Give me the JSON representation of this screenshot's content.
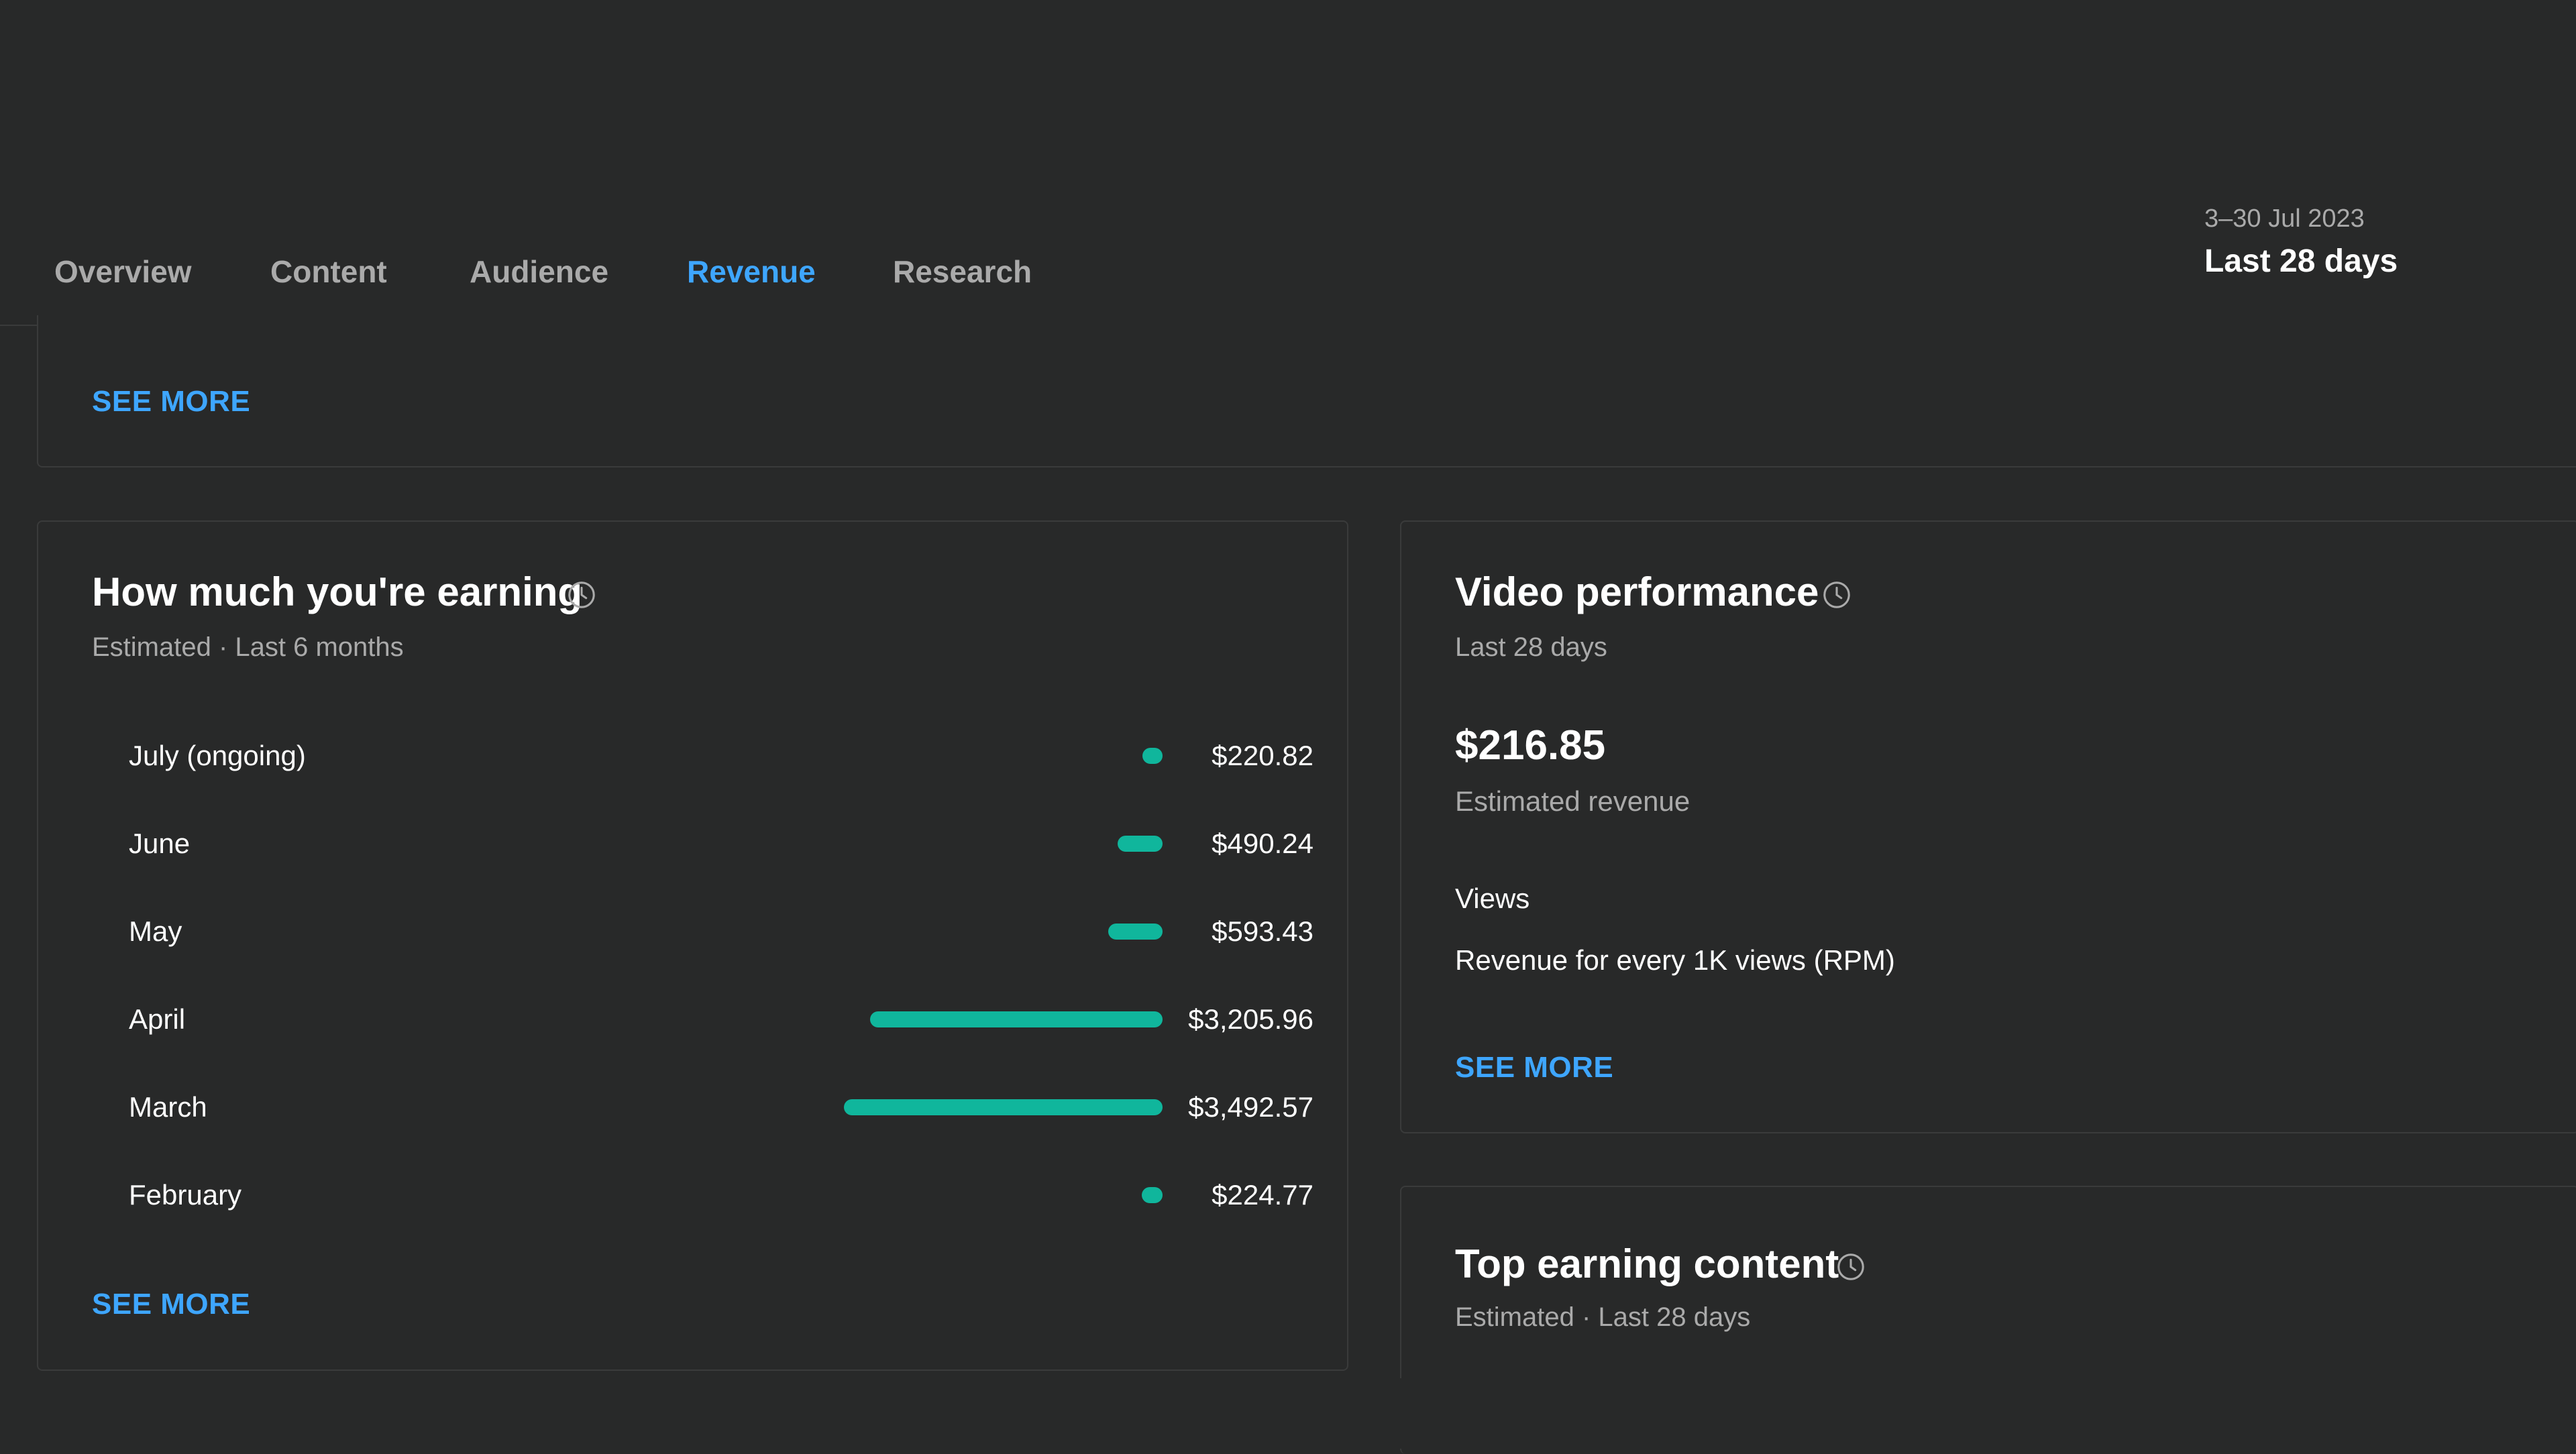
{
  "header": {
    "tabs": [
      {
        "label": "Overview",
        "active": false
      },
      {
        "label": "Content",
        "active": false
      },
      {
        "label": "Audience",
        "active": false
      },
      {
        "label": "Revenue",
        "active": true
      },
      {
        "label": "Research",
        "active": false
      }
    ],
    "date_range": "3–30 Jul 2023",
    "date_label": "Last 28 days",
    "accent_color": "#3ea6ff"
  },
  "top_card": {
    "see_more": "SEE MORE"
  },
  "earning_card": {
    "title": "How much you're earning",
    "subtitle": "Estimated · Last 6 months",
    "see_more": "SEE MORE",
    "bar_color": "#10b69c",
    "rows": [
      {
        "month": "July (ongoing)",
        "value": "$220.82",
        "amount": 220.82
      },
      {
        "month": "June",
        "value": "$490.24",
        "amount": 490.24
      },
      {
        "month": "May",
        "value": "$593.43",
        "amount": 593.43
      },
      {
        "month": "April",
        "value": "$3,205.96",
        "amount": 3205.96
      },
      {
        "month": "March",
        "value": "$3,492.57",
        "amount": 3492.57
      },
      {
        "month": "February",
        "value": "$224.77",
        "amount": 224.77
      }
    ]
  },
  "video_card": {
    "title": "Video performance",
    "subtitle": "Last 28 days",
    "revenue": "$216.85",
    "revenue_label": "Estimated revenue",
    "views_label": "Views",
    "rpm_label": "Revenue for every 1K views (RPM)",
    "see_more": "SEE MORE"
  },
  "top_content_card": {
    "title": "Top earning content",
    "subtitle": "Estimated · Last 28 days"
  }
}
